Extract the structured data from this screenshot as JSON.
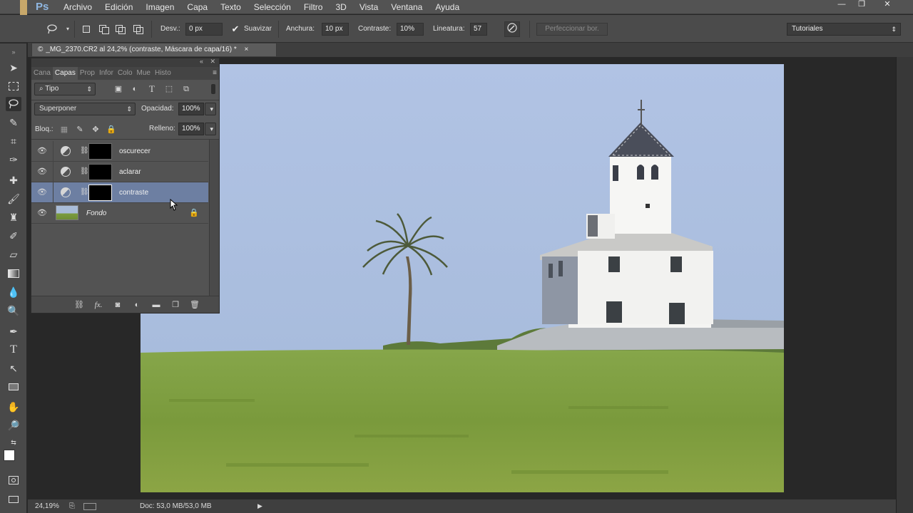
{
  "app": {
    "logo": "Ps",
    "menu": [
      "Archivo",
      "Edición",
      "Imagen",
      "Capa",
      "Texto",
      "Selección",
      "Filtro",
      "3D",
      "Vista",
      "Ventana",
      "Ayuda"
    ],
    "window_controls": {
      "minimize": "—",
      "restore": "❐",
      "close": "✕"
    }
  },
  "options": {
    "desv_label": "Desv.:",
    "desv_value": "0 px",
    "suavizar_label": "Suavizar",
    "suavizar_checked": true,
    "anchura_label": "Anchura:",
    "anchura_value": "10 px",
    "contraste_label": "Contraste:",
    "contraste_value": "10%",
    "lineatura_label": "Lineatura:",
    "lineatura_value": "57",
    "refine_button": "Perfeccionar bor.",
    "workspace": "Tutoriales"
  },
  "document": {
    "tab_title": "_MG_2370.CR2 al 24,2% (contraste, Máscara de capa/16) *"
  },
  "layers_panel": {
    "tabs": [
      "Cana",
      "Capas",
      "Prop",
      "Infor",
      "Colo",
      "Mue",
      "Histo"
    ],
    "active_tab": "Capas",
    "filter_kind": "Tipo",
    "blend_mode": "Superponer",
    "opacity_label": "Opacidad:",
    "opacity_value": "100%",
    "lock_label": "Bloq.:",
    "fill_label": "Relleno:",
    "fill_value": "100%",
    "layers": [
      {
        "name": "oscurecer",
        "type": "adjustment",
        "selected": false
      },
      {
        "name": "aclarar",
        "type": "adjustment",
        "selected": false
      },
      {
        "name": "contraste",
        "type": "adjustment",
        "selected": true
      },
      {
        "name": "Fondo",
        "type": "background",
        "selected": false,
        "locked": true
      }
    ]
  },
  "status": {
    "zoom": "24,19%",
    "doc_info": "Doc: 53,0 MB/53,0 MB"
  }
}
